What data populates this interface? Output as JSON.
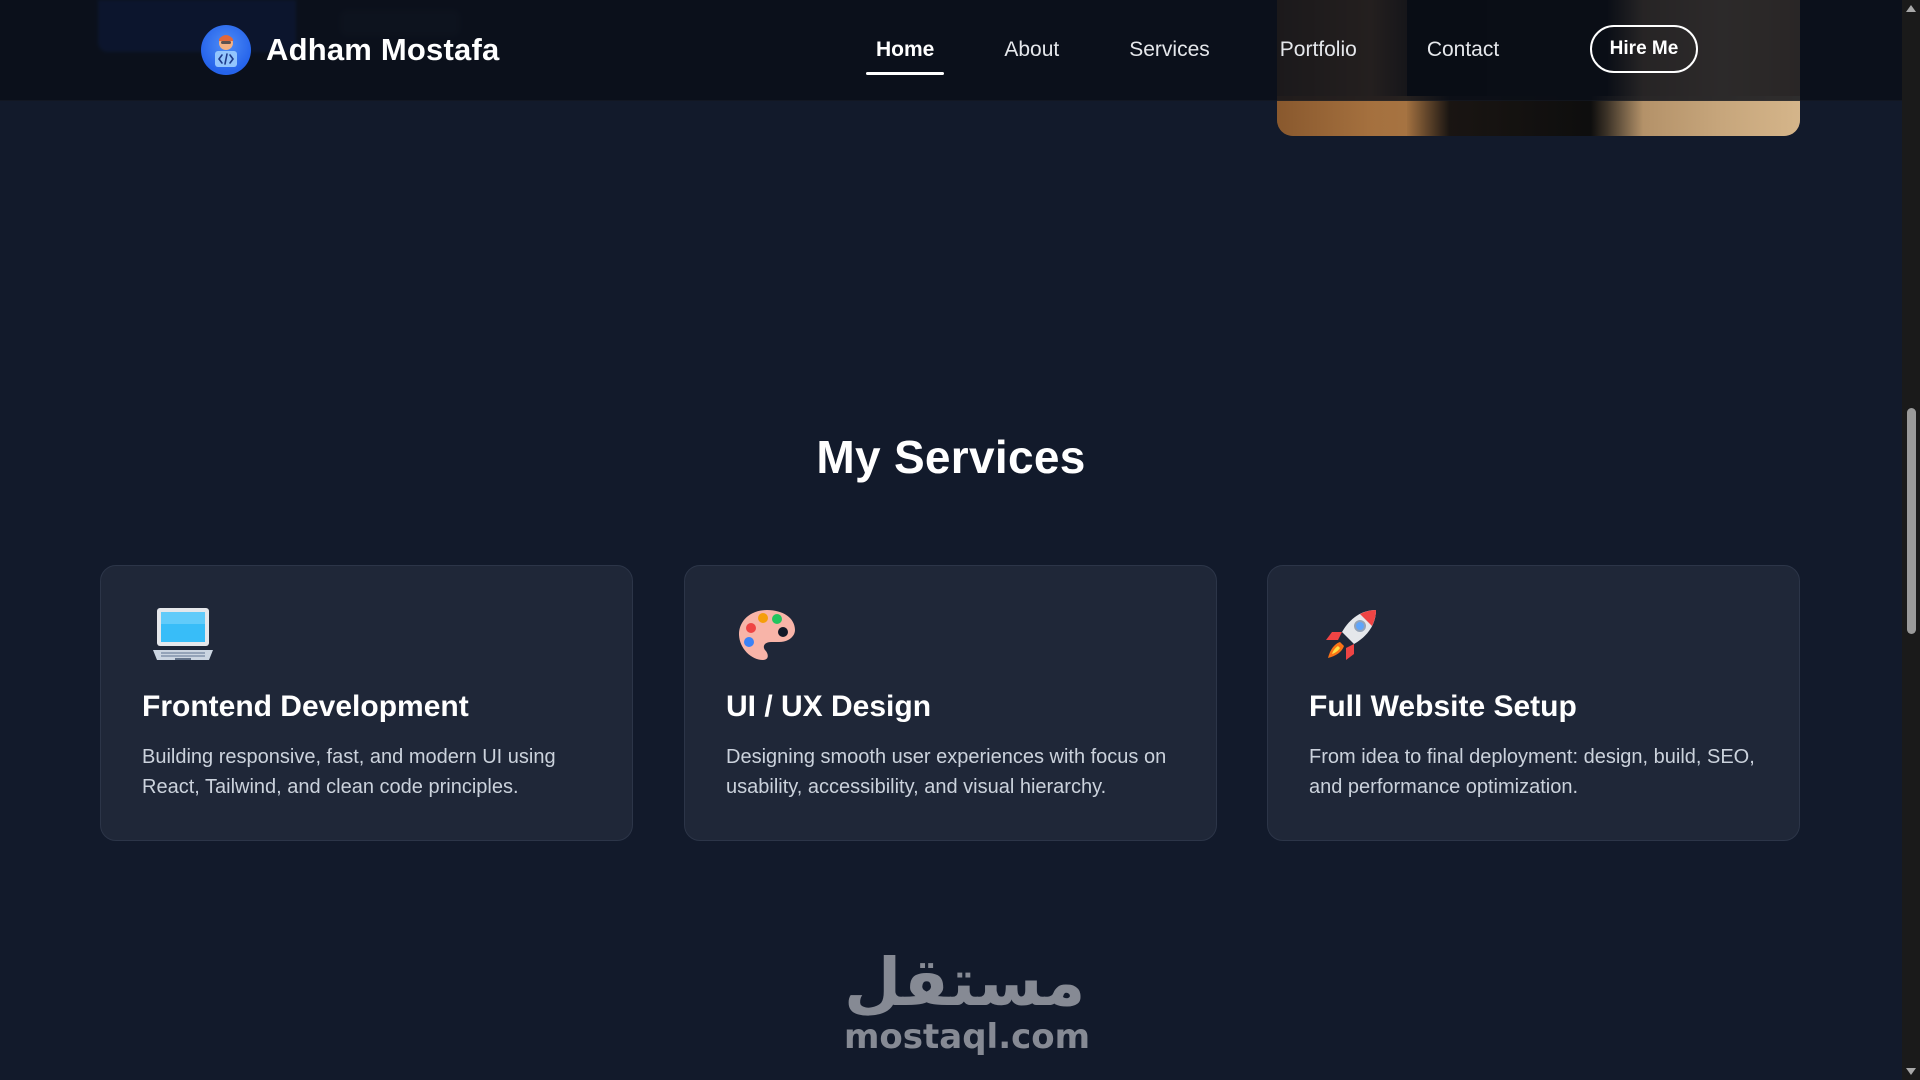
{
  "header": {
    "brand_name": "Adham Mostafa",
    "avatar_icon": "developer-avatar-icon",
    "nav": [
      {
        "label": "Home",
        "active": true
      },
      {
        "label": "About",
        "active": false
      },
      {
        "label": "Services",
        "active": false
      },
      {
        "label": "Portfolio",
        "active": false
      },
      {
        "label": "Contact",
        "active": false
      }
    ],
    "cta_label": "Hire Me"
  },
  "services": {
    "title": "My Services",
    "cards": [
      {
        "icon": "laptop-icon",
        "title": "Frontend Development",
        "description": "Building responsive, fast, and modern UI using React, Tailwind, and clean code principles."
      },
      {
        "icon": "palette-icon",
        "title": "UI / UX Design",
        "description": "Designing smooth user experiences with focus on usability, accessibility, and visual hierarchy."
      },
      {
        "icon": "rocket-icon",
        "title": "Full Website Setup",
        "description": "From idea to final deployment: design, build, SEO, and performance optimization."
      }
    ]
  },
  "watermark": {
    "arabic": "مستقل",
    "latin": "mostaql.com"
  },
  "colors": {
    "background": "#121a2b",
    "card": "#1f2738",
    "accent": "#2563eb",
    "text": "#ffffff"
  }
}
